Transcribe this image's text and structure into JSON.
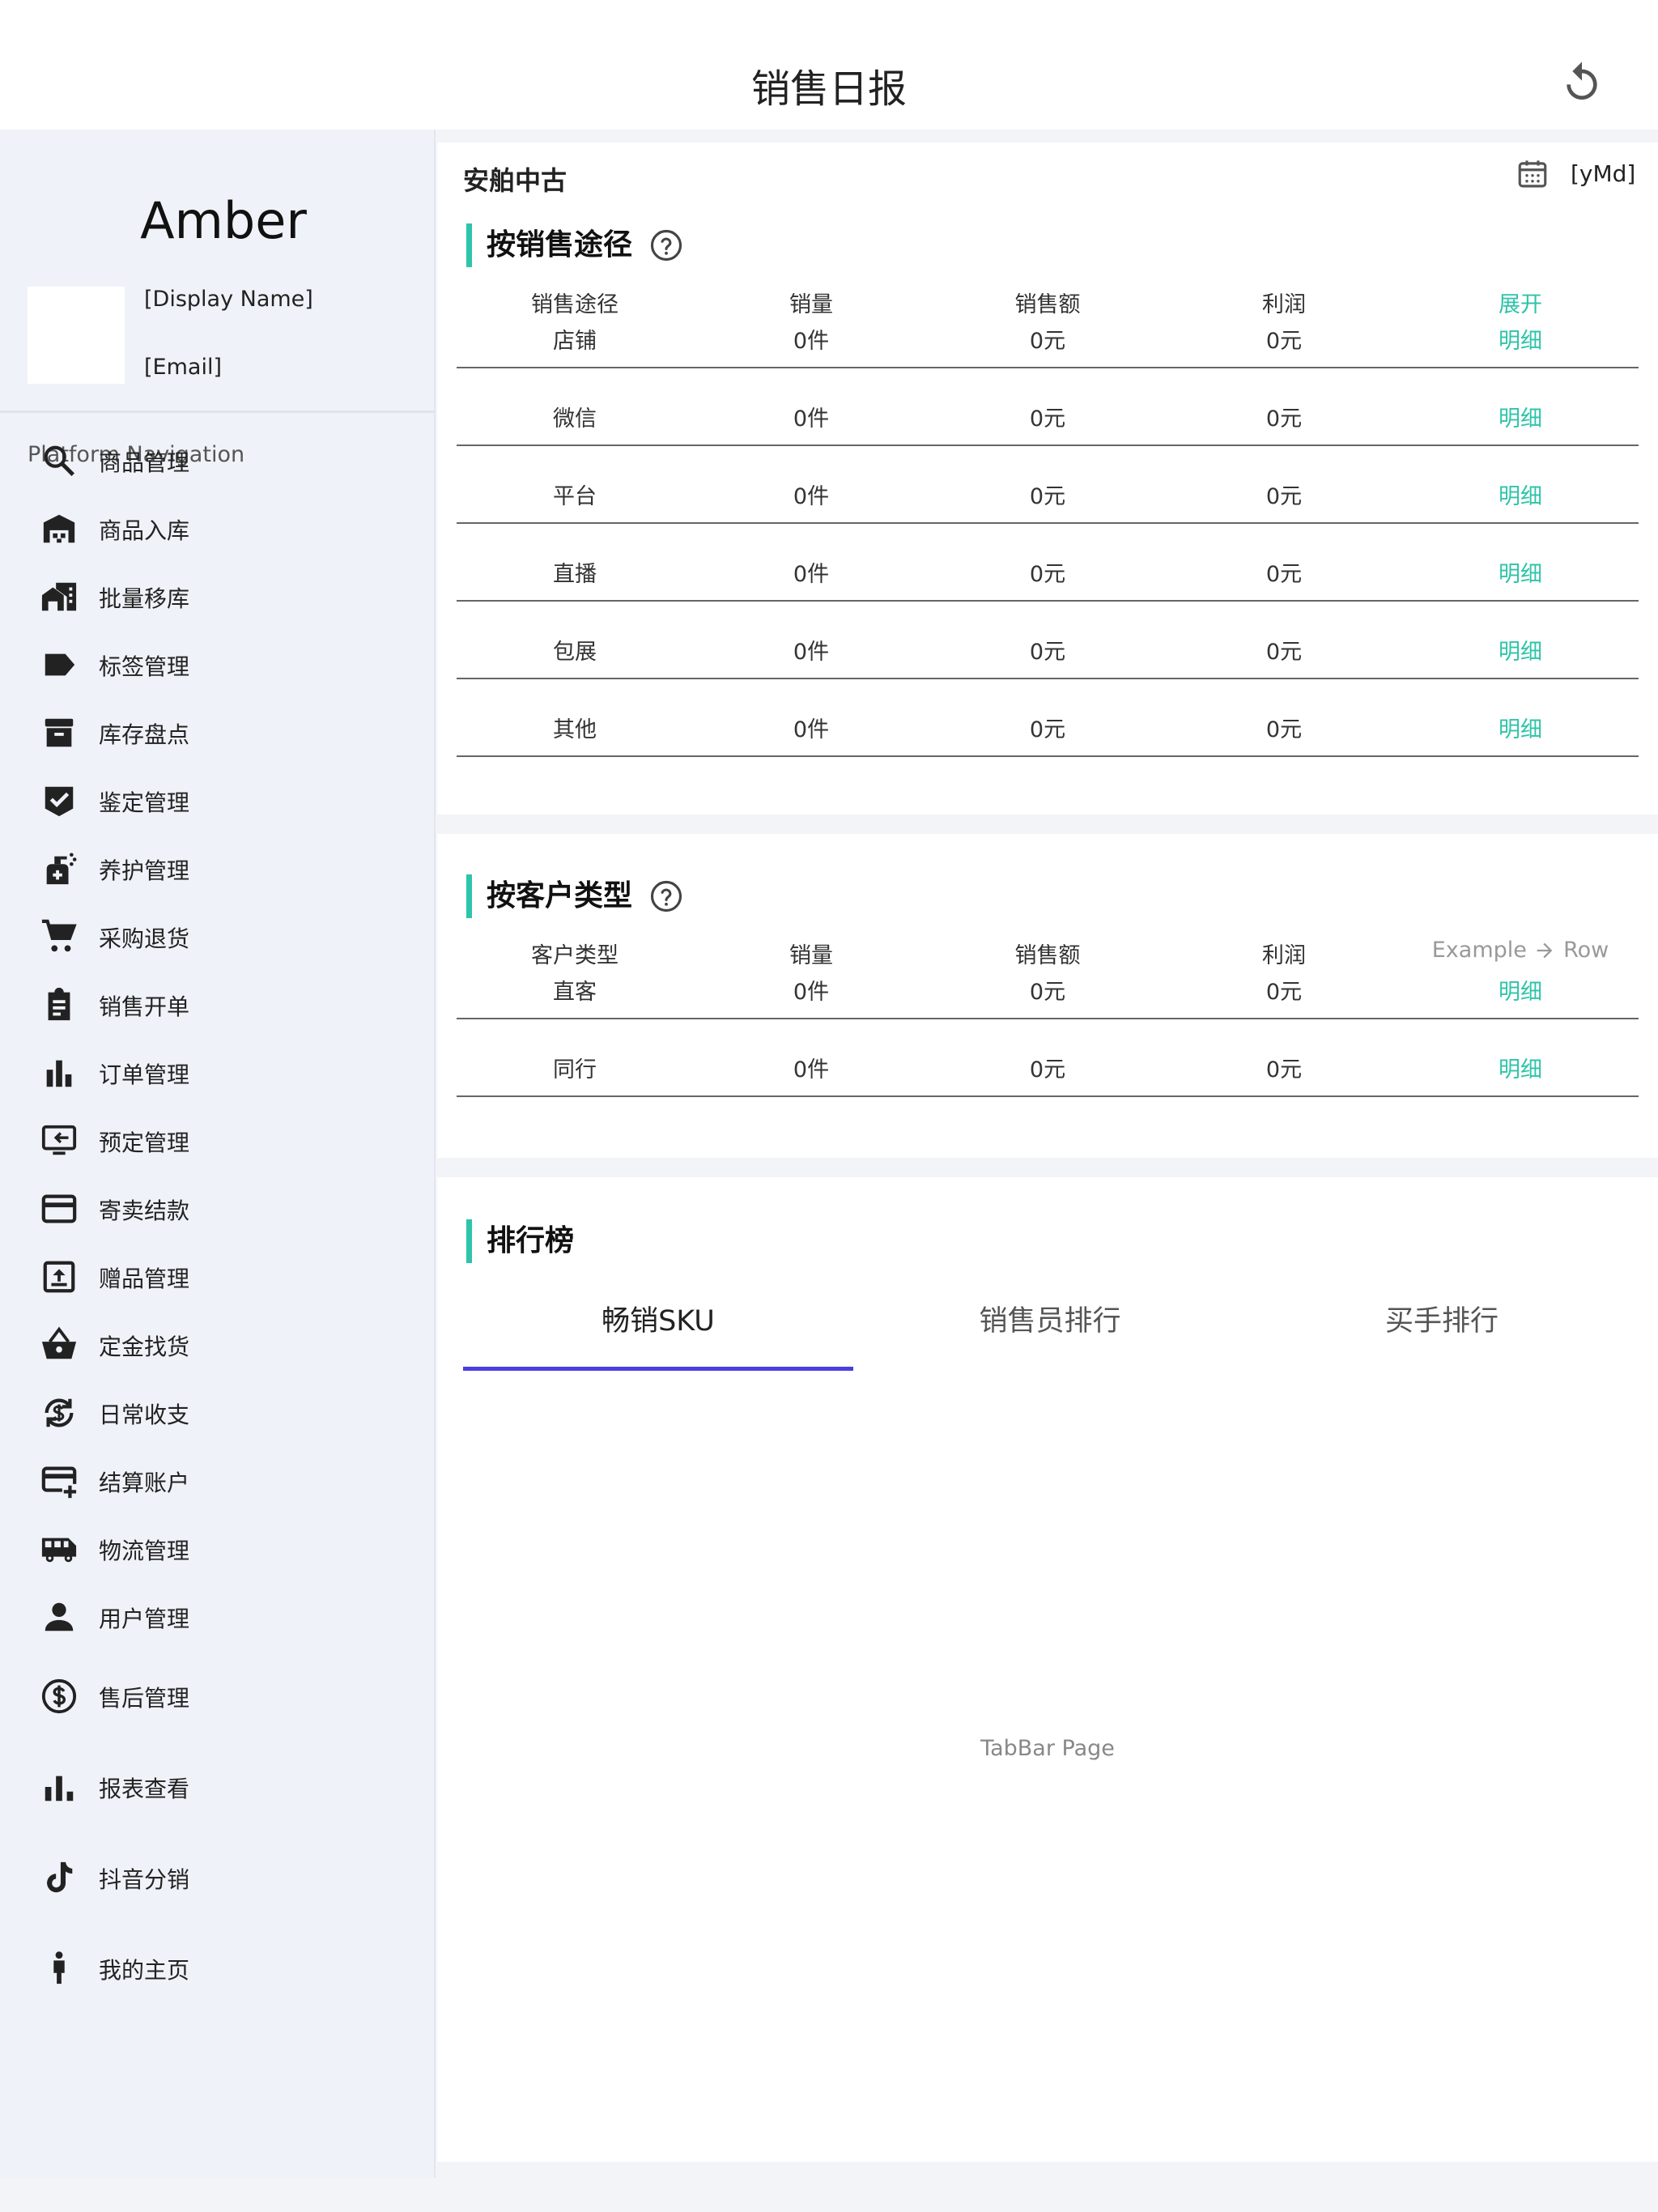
{
  "header": {
    "title": "销售日报"
  },
  "sidebar": {
    "app_name": "Amber",
    "display_name": "[Display Name]",
    "email": "[Email]",
    "nav_title": "Platform Navigation",
    "items": [
      {
        "label": "商品管理",
        "icon": "search-icon"
      },
      {
        "label": "商品入库",
        "icon": "warehouse-icon"
      },
      {
        "label": "批量移库",
        "icon": "home-work-icon"
      },
      {
        "label": "标签管理",
        "icon": "label-icon"
      },
      {
        "label": "库存盘点",
        "icon": "archive-icon"
      },
      {
        "label": "鉴定管理",
        "icon": "verified-icon"
      },
      {
        "label": "养护管理",
        "icon": "sanitizer-icon"
      },
      {
        "label": "采购退货",
        "icon": "cart-icon"
      },
      {
        "label": "销售开单",
        "icon": "clipboard-icon"
      },
      {
        "label": "订单管理",
        "icon": "bar-chart-icon"
      },
      {
        "label": "预定管理",
        "icon": "monitor-swap-icon"
      },
      {
        "label": "寄卖结款",
        "icon": "credit-card-icon"
      },
      {
        "label": "赠品管理",
        "icon": "upload-box-icon"
      },
      {
        "label": "定金找货",
        "icon": "basket-icon"
      },
      {
        "label": "日常收支",
        "icon": "currency-exchange-icon"
      },
      {
        "label": "结算账户",
        "icon": "add-card-icon"
      },
      {
        "label": "物流管理",
        "icon": "bus-icon"
      },
      {
        "label": "用户管理",
        "icon": "person-icon"
      },
      {
        "label": "售后管理",
        "icon": "dollar-circle-icon"
      },
      {
        "label": "报表查看",
        "icon": "stats-icon"
      },
      {
        "label": "抖音分销",
        "icon": "tiktok-icon"
      },
      {
        "label": "我的主页",
        "icon": "man-icon"
      }
    ]
  },
  "filter": {
    "store": "安舶中古",
    "date": "[yMd]"
  },
  "by_channel": {
    "title": "按销售途径",
    "headers": [
      "销售途径",
      "销量",
      "销售额",
      "利润",
      "展开"
    ],
    "rows": [
      {
        "name": "店铺",
        "qty": "0件",
        "amount": "0元",
        "profit": "0元",
        "action": "明细"
      },
      {
        "name": "微信",
        "qty": "0件",
        "amount": "0元",
        "profit": "0元",
        "action": "明细"
      },
      {
        "name": "平台",
        "qty": "0件",
        "amount": "0元",
        "profit": "0元",
        "action": "明细"
      },
      {
        "name": "直播",
        "qty": "0件",
        "amount": "0元",
        "profit": "0元",
        "action": "明细"
      },
      {
        "name": "包展",
        "qty": "0件",
        "amount": "0元",
        "profit": "0元",
        "action": "明细"
      },
      {
        "name": "其他",
        "qty": "0件",
        "amount": "0元",
        "profit": "0元",
        "action": "明细"
      }
    ]
  },
  "by_customer": {
    "title": "按客户类型",
    "headers": [
      "客户类型",
      "销量",
      "销售额",
      "利润"
    ],
    "example_label": "Example",
    "row_label": "Row",
    "rows": [
      {
        "name": "直客",
        "qty": "0件",
        "amount": "0元",
        "profit": "0元",
        "action": "明细"
      },
      {
        "name": "同行",
        "qty": "0件",
        "amount": "0元",
        "profit": "0元",
        "action": "明细"
      }
    ]
  },
  "ranking": {
    "title": "排行榜",
    "tabs": [
      "畅销SKU",
      "销售员排行",
      "买手排行"
    ],
    "active_tab": 0,
    "tab_page": "TabBar Page"
  },
  "colors": {
    "accent": "#2ec4a9",
    "tab_indicator": "#4a3fe0"
  }
}
